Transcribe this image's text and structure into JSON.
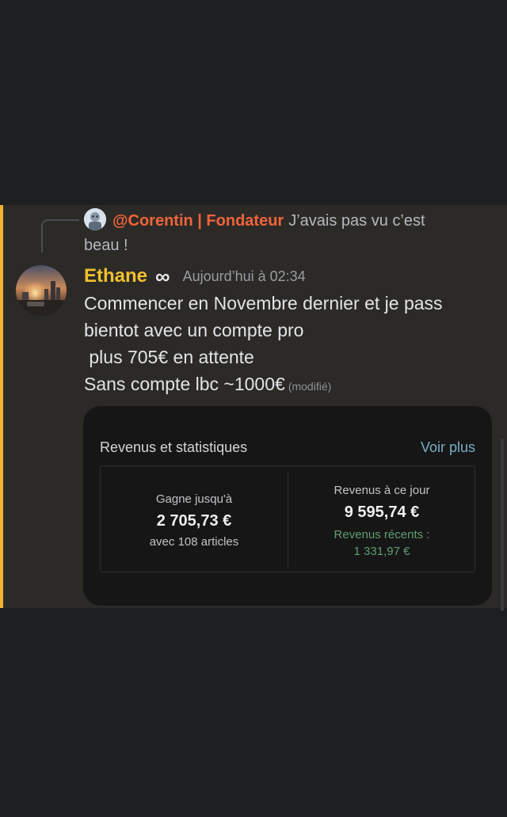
{
  "reply": {
    "author": "@Corentin | Fondateur",
    "text": "J’avais pas vu c’est beau !"
  },
  "message": {
    "author": "Ethane",
    "badge_icon": "infinity-icon",
    "badge_glyph": "∞",
    "timestamp": "Aujourd’hui à 02:34",
    "lines": [
      "Commencer en Novembre dernier et je pass",
      "bientot avec un compte pro",
      " plus 705€ en attente",
      "Sans compte lbc ~1000€"
    ],
    "edited_label": "(modifié)"
  },
  "embed": {
    "title": "Revenus et statistiques",
    "link_label": "Voir plus",
    "left": {
      "label": "Gagne jusqu'à",
      "value": "2 705,73 €",
      "sub": "avec 108 articles"
    },
    "right": {
      "label": "Revenus à ce jour",
      "value": "9 595,74 €",
      "recent_label": "Revenus récents :",
      "recent_value": "1 331,97 €"
    }
  },
  "colors": {
    "highlight": "#f0b232",
    "reply_author": "#f0643c",
    "author": "#f0c02f",
    "link": "#79aec3",
    "recent": "#5f9e6e"
  }
}
